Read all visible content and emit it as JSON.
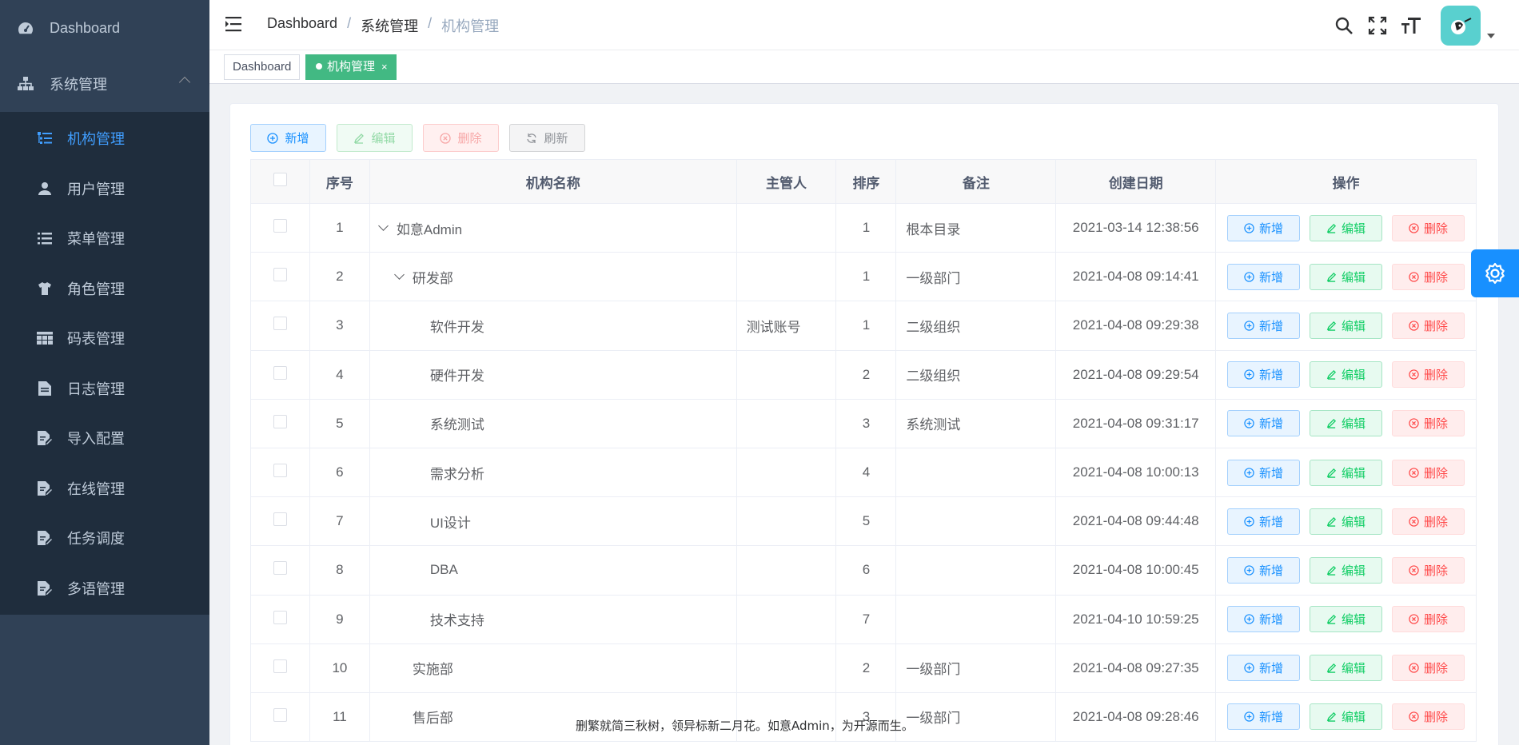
{
  "sidebar": {
    "dashboard": "Dashboard",
    "group": "系统管理",
    "items": [
      {
        "label": "机构管理",
        "icon": "tree-table-icon",
        "active": true
      },
      {
        "label": "用户管理",
        "icon": "user-icon"
      },
      {
        "label": "菜单管理",
        "icon": "list-icon"
      },
      {
        "label": "角色管理",
        "icon": "shirt-icon"
      },
      {
        "label": "码表管理",
        "icon": "table-icon"
      },
      {
        "label": "日志管理",
        "icon": "document-icon"
      },
      {
        "label": "导入配置",
        "icon": "edit-document-icon"
      },
      {
        "label": "在线管理",
        "icon": "edit-document-icon"
      },
      {
        "label": "任务调度",
        "icon": "edit-document-icon"
      },
      {
        "label": "多语管理",
        "icon": "edit-document-icon"
      }
    ]
  },
  "breadcrumb": [
    "Dashboard",
    "系统管理",
    "机构管理"
  ],
  "breadcrumb_sep": "/",
  "tags": [
    {
      "label": "Dashboard",
      "active": false
    },
    {
      "label": "机构管理",
      "active": true,
      "close": "×"
    }
  ],
  "toolbar": {
    "add": "新增",
    "edit": "编辑",
    "delete": "删除",
    "refresh": "刷新"
  },
  "table": {
    "headers": [
      "序号",
      "机构名称",
      "主管人",
      "排序",
      "备注",
      "创建日期",
      "操作"
    ],
    "rows": [
      {
        "no": "1",
        "name": "如意Admin",
        "level": 0,
        "expand": true,
        "manager": "",
        "sort": "1",
        "remark": "根本目录",
        "date": "2021-03-14 12:38:56"
      },
      {
        "no": "2",
        "name": "研发部",
        "level": 1,
        "expand": true,
        "manager": "",
        "sort": "1",
        "remark": "一级部门",
        "date": "2021-04-08 09:14:41"
      },
      {
        "no": "3",
        "name": "软件开发",
        "level": 2,
        "expand": false,
        "manager": "测试账号",
        "sort": "1",
        "remark": "二级组织",
        "date": "2021-04-08 09:29:38"
      },
      {
        "no": "4",
        "name": "硬件开发",
        "level": 2,
        "expand": false,
        "manager": "",
        "sort": "2",
        "remark": "二级组织",
        "date": "2021-04-08 09:29:54"
      },
      {
        "no": "5",
        "name": "系统测试",
        "level": 2,
        "expand": false,
        "manager": "",
        "sort": "3",
        "remark": "系统测试",
        "date": "2021-04-08 09:31:17"
      },
      {
        "no": "6",
        "name": "需求分析",
        "level": 2,
        "expand": false,
        "manager": "",
        "sort": "4",
        "remark": "",
        "date": "2021-04-08 10:00:13"
      },
      {
        "no": "7",
        "name": "UI设计",
        "level": 2,
        "expand": false,
        "manager": "",
        "sort": "5",
        "remark": "",
        "date": "2021-04-08 09:44:48"
      },
      {
        "no": "8",
        "name": "DBA",
        "level": 2,
        "expand": false,
        "manager": "",
        "sort": "6",
        "remark": "",
        "date": "2021-04-08 10:00:45"
      },
      {
        "no": "9",
        "name": "技术支持",
        "level": 2,
        "expand": false,
        "manager": "",
        "sort": "7",
        "remark": "",
        "date": "2021-04-10 10:59:25"
      },
      {
        "no": "10",
        "name": "实施部",
        "level": 1,
        "expand": false,
        "manager": "",
        "sort": "2",
        "remark": "一级部门",
        "date": "2021-04-08 09:27:35"
      },
      {
        "no": "11",
        "name": "售后部",
        "level": 1,
        "expand": false,
        "manager": "",
        "sort": "3",
        "remark": "一级部门",
        "date": "2021-04-08 09:28:46"
      }
    ],
    "row_actions": {
      "add": "新增",
      "edit": "编辑",
      "delete": "删除"
    }
  },
  "footer": "删繁就简三秋树，领异标新二月花。如意Admin，为开源而生。",
  "colors": {
    "sidebar_bg": "#304156",
    "active_blue": "#409eff",
    "tag_green": "#42b983",
    "settings_blue": "#1890ff"
  }
}
